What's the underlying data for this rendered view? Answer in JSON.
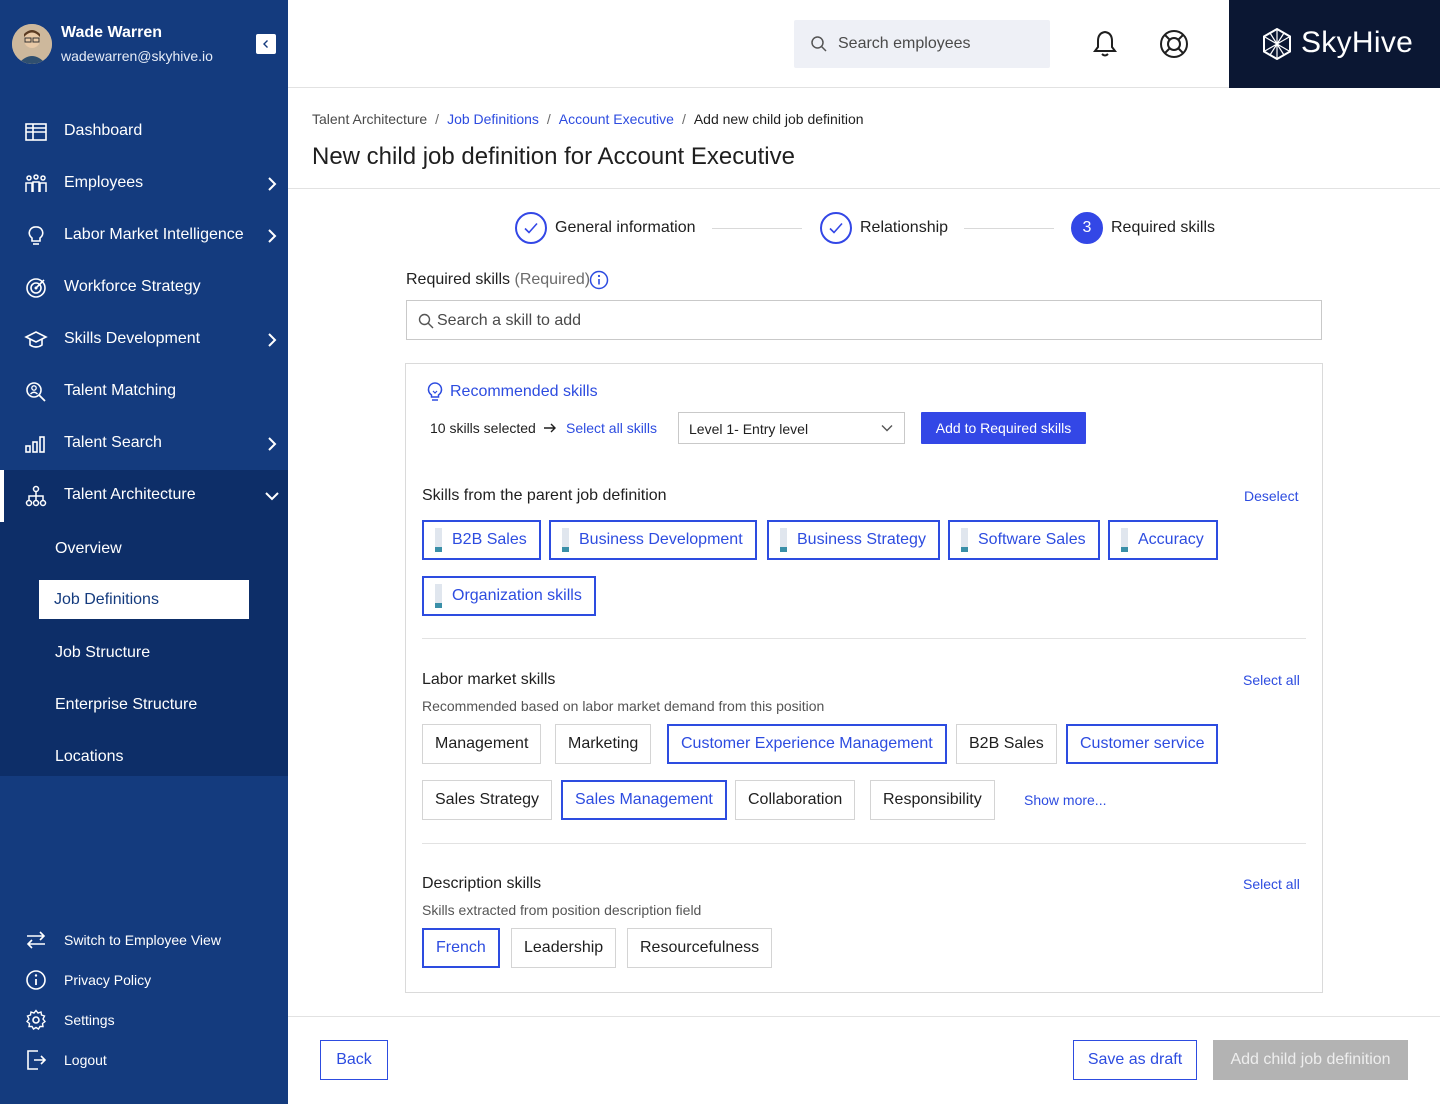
{
  "colors": {
    "sidebar": "#143b7e",
    "sidebar_active": "#0d2e68",
    "accent": "#3347e6",
    "link": "#2d4ce0",
    "brand_bg": "#0b1733",
    "disabled": "#b3b3b3"
  },
  "profile": {
    "name": "Wade Warren",
    "email": "wadewarren@skyhive.io"
  },
  "nav": [
    {
      "label": "Dashboard",
      "icon": "grid-icon"
    },
    {
      "label": "Employees",
      "icon": "people-icon"
    },
    {
      "label": "Labor Market Intelligence",
      "icon": "lightbulb-icon"
    },
    {
      "label": "Workforce Strategy",
      "icon": "target-icon"
    },
    {
      "label": "Skills Development",
      "icon": "graduation-cap-icon"
    },
    {
      "label": "Talent Matching",
      "icon": "person-search-icon"
    },
    {
      "label": "Talent Search",
      "icon": "bar-chart-icon"
    },
    {
      "label": "Talent Architecture",
      "icon": "hierarchy-icon"
    }
  ],
  "subnav": [
    "Overview",
    "Job Definitions",
    "Job Structure",
    "Enterprise Structure",
    "Locations"
  ],
  "footer_links": [
    "Switch to Employee View",
    "Privacy Policy",
    "Settings",
    "Logout"
  ],
  "header": {
    "search_placeholder": "Search employees",
    "brand": "SkyHive"
  },
  "breadcrumb": {
    "root": "Talent Architecture",
    "job_definitions": "Job Definitions",
    "parent": "Account Executive",
    "current": "Add new child job definition"
  },
  "page_title": "New child job definition for Account Executive",
  "stepper": [
    {
      "label": "General information",
      "state": "done"
    },
    {
      "label": "Relationship",
      "state": "done"
    },
    {
      "label": "Required skills",
      "number": "3",
      "state": "active"
    }
  ],
  "required": {
    "label": "Required skills",
    "hint": "(Required)",
    "search_placeholder": "Search a skill to add"
  },
  "recommended": {
    "title": "Recommended skills",
    "selected_count": "10 skills selected",
    "select_all": "Select all skills",
    "level": "Level 1- Entry level",
    "add_button": "Add to Required skills"
  },
  "parent_skills": {
    "title": "Skills from the parent job definition",
    "action": "Deselect",
    "chips": [
      "B2B Sales",
      "Business Development",
      "Business Strategy",
      "Software Sales",
      "Accuracy",
      "Organization skills"
    ]
  },
  "labor_skills": {
    "title": "Labor market skills",
    "subtitle": "Recommended based on labor market demand from this position",
    "action": "Select all",
    "chips": [
      {
        "label": "Management",
        "selected": false
      },
      {
        "label": "Marketing",
        "selected": false
      },
      {
        "label": "Customer Experience Management",
        "selected": true
      },
      {
        "label": "B2B Sales",
        "selected": false
      },
      {
        "label": "Customer service",
        "selected": true
      },
      {
        "label": "Sales Strategy",
        "selected": false
      },
      {
        "label": "Sales Management",
        "selected": true
      },
      {
        "label": "Collaboration",
        "selected": false
      },
      {
        "label": "Responsibility",
        "selected": false
      }
    ],
    "show_more": "Show more..."
  },
  "description_skills": {
    "title": "Description skills",
    "subtitle": "Skills extracted from position description field",
    "action": "Select all",
    "chips": [
      {
        "label": "French",
        "selected": true
      },
      {
        "label": "Leadership",
        "selected": false
      },
      {
        "label": "Resourcefulness",
        "selected": false
      }
    ]
  },
  "footer": {
    "back": "Back",
    "draft": "Save as draft",
    "submit": "Add child job definition"
  }
}
